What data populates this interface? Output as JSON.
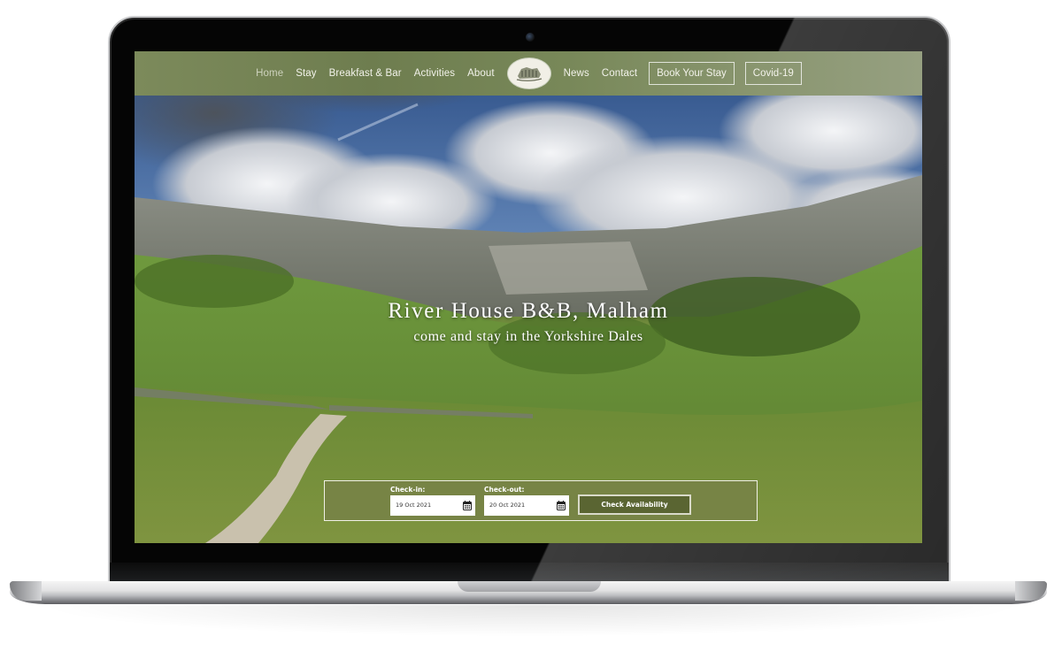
{
  "site": {
    "logo_alt": "River House B&B logo"
  },
  "nav": {
    "items": [
      {
        "label": "Home",
        "active": true
      },
      {
        "label": "Stay"
      },
      {
        "label": "Breakfast & Bar"
      },
      {
        "label": "Activities"
      },
      {
        "label": "About"
      }
    ],
    "items_right": [
      {
        "label": "News"
      },
      {
        "label": "Contact"
      }
    ],
    "buttons": [
      {
        "label": "Book Your Stay"
      },
      {
        "label": "Covid-19"
      }
    ]
  },
  "hero": {
    "title": "River House B&B, Malham",
    "subtitle": "come and stay in the Yorkshire Dales",
    "image_description": "Malham Cove limestone cliff, green valley with footpath, cloudy blue sky"
  },
  "booking": {
    "checkin_label": "Check-in:",
    "checkin_value": "19 Oct 2021",
    "checkout_label": "Check-out:",
    "checkout_value": "20 Oct 2021",
    "submit_label": "Check Availability",
    "calendar_icon": "calendar-icon"
  },
  "colors": {
    "brand_green": "#778445",
    "nav_green": "#7c8a5b",
    "button_dark_green": "#5a6532"
  }
}
